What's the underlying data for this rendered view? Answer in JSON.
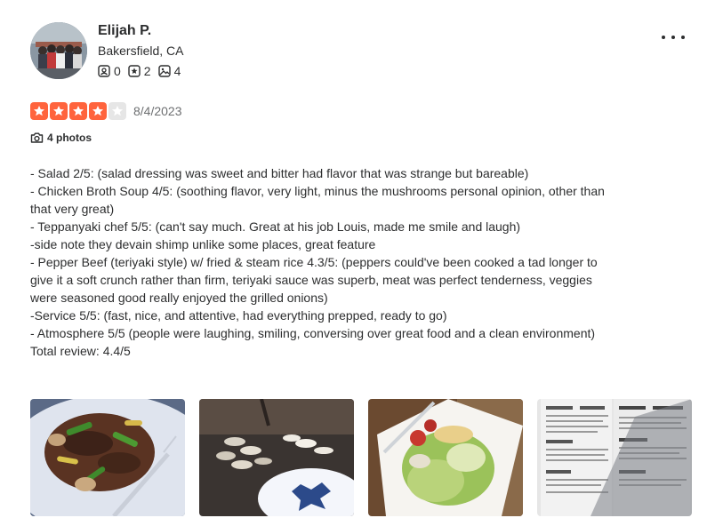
{
  "user": {
    "name": "Elijah P.",
    "location": "Bakersfield, CA",
    "stats": [
      {
        "icon": "friends-icon",
        "count": "0"
      },
      {
        "icon": "review-star-icon",
        "count": "2"
      },
      {
        "icon": "photo-icon",
        "count": "4"
      }
    ]
  },
  "review": {
    "rating": 4,
    "rating_max": 5,
    "star_color": "#ff643d",
    "star_empty_color": "#e6e6e6",
    "date": "8/4/2023",
    "photos_label": "4 photos",
    "lines": [
      "- Salad 2/5: (salad dressing was sweet and bitter had flavor that was strange but bareable)",
      "- Chicken Broth Soup 4/5: (soothing flavor, very light, minus the mushrooms personal opinion, other than that very great)",
      "- Teppanyaki chef 5/5: (can't say much. Great at his job Louis, made me smile and laugh)",
      "-side note they devain shimp unlike some places, great feature",
      "- Pepper Beef (teriyaki style) w/ fried & steam rice 4.3/5: (peppers could've been cooked a tad longer to give it a soft crunch rather than firm, teriyaki sauce was superb, meat was perfect tenderness, veggies were seasoned good really enjoyed the grilled onions)",
      "-Service 5/5: (fast, nice, and attentive, had everything prepped, ready to go)",
      "- Atmosphere 5/5 (people were laughing, smiling, conversing over great food and a clean environment)",
      "Total review: 4.4/5"
    ]
  },
  "photos": [
    {
      "name": "photo-pepper-beef"
    },
    {
      "name": "photo-teppanyaki-grill"
    },
    {
      "name": "photo-salad"
    },
    {
      "name": "photo-menu"
    }
  ]
}
